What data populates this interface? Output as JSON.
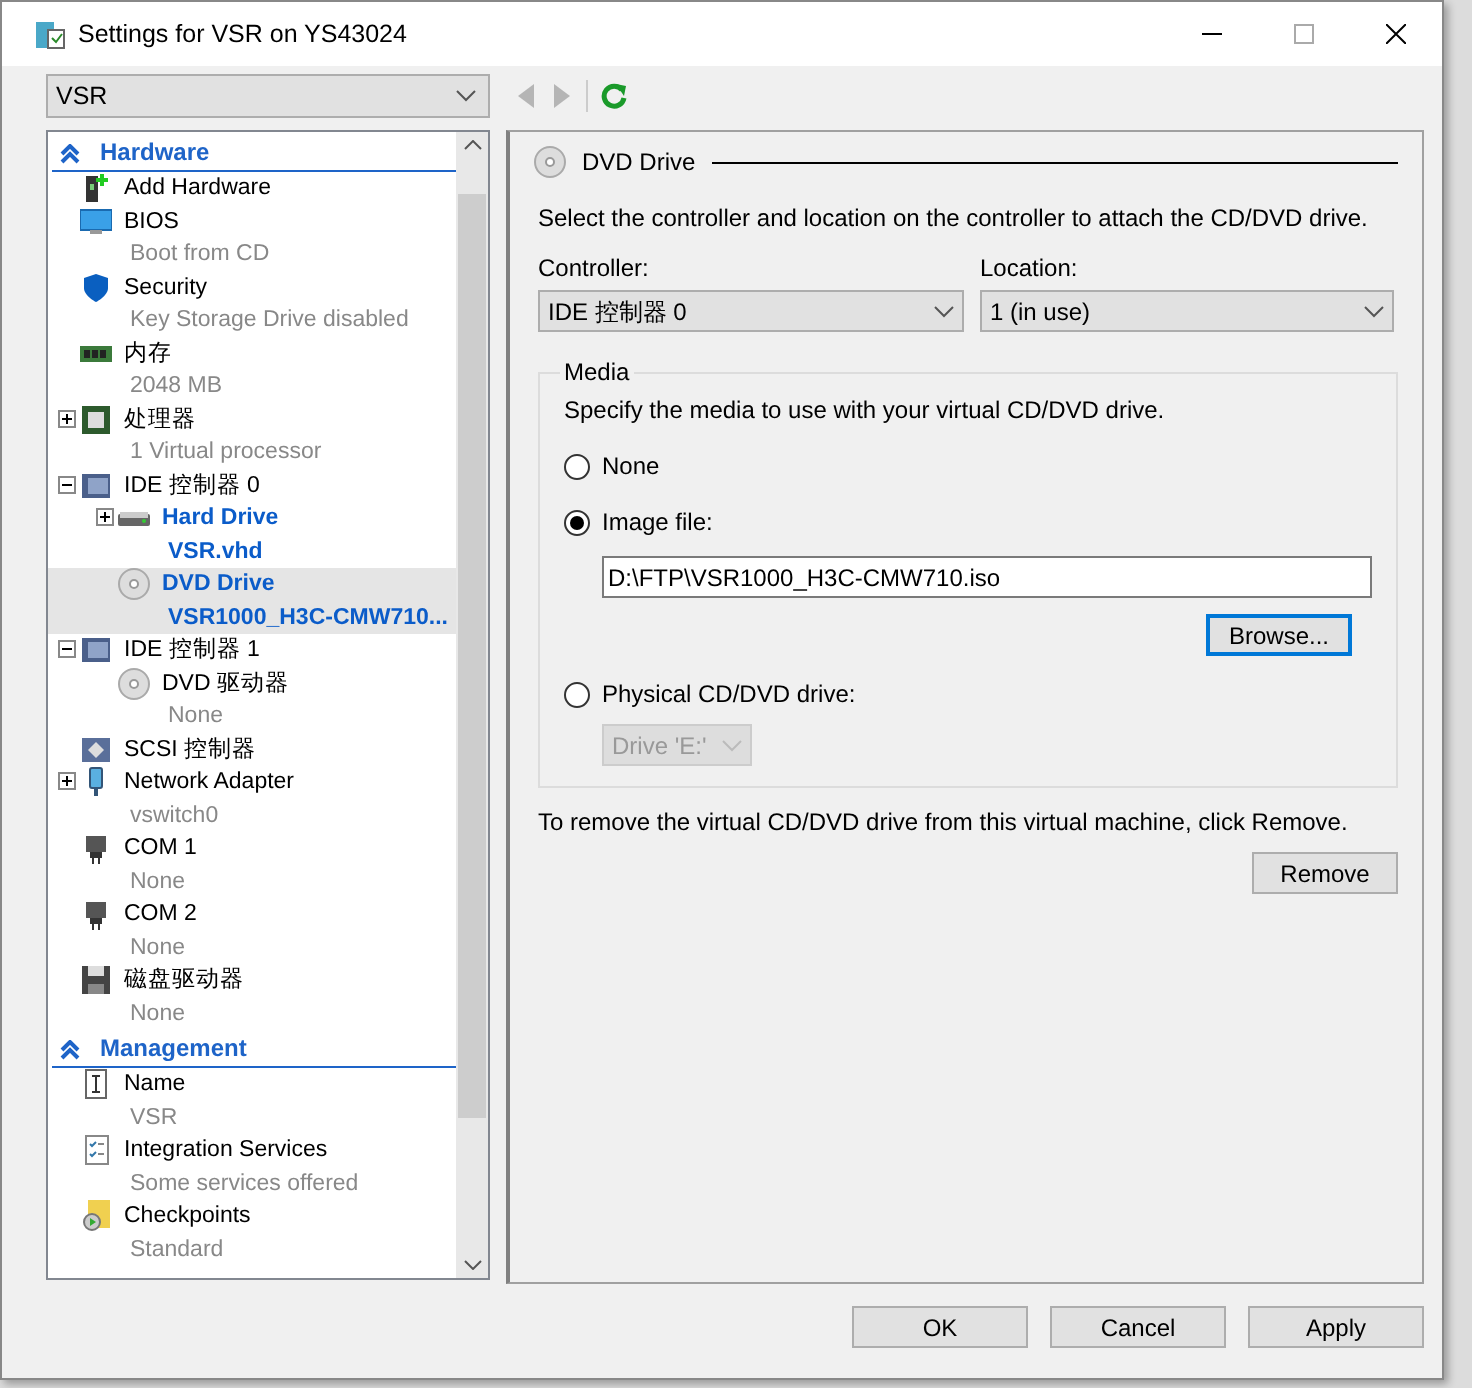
{
  "window": {
    "title": "Settings for VSR on YS43024"
  },
  "vm_selector": {
    "value": "VSR"
  },
  "tree": [
    {
      "kind": "section",
      "name": "Hardware",
      "expanded": true
    },
    {
      "kind": "add-hardware",
      "name": "Add Hardware",
      "selected": false
    },
    {
      "kind": "bios",
      "name": "BIOS",
      "detail": "Boot from CD",
      "selected": false
    },
    {
      "kind": "security",
      "name": "Security",
      "detail": "Key Storage Drive disabled",
      "selected": false
    },
    {
      "kind": "memory",
      "name": "内存",
      "detail": "2048 MB",
      "selected": false
    },
    {
      "kind": "processor",
      "name": "处理器",
      "detail": "1 Virtual processor",
      "expanded": false,
      "selected": false
    },
    {
      "kind": "controller",
      "name": "IDE 控制器 0",
      "expanded": true,
      "selected": false,
      "children": [
        {
          "kind": "hard-drive",
          "name": "Hard Drive",
          "detail": "VSR.vhd",
          "modified": true,
          "expanded": false,
          "selected": false
        },
        {
          "kind": "dvd",
          "name": "DVD Drive",
          "detail": "VSR1000_H3C-CMW710...",
          "modified": true,
          "selected": true
        }
      ]
    },
    {
      "kind": "controller",
      "name": "IDE 控制器 1",
      "expanded": true,
      "selected": false,
      "children": [
        {
          "kind": "dvd",
          "name": "DVD 驱动器",
          "detail": "None",
          "modified": false,
          "selected": false
        }
      ]
    },
    {
      "kind": "scsi",
      "name": "SCSI 控制器",
      "selected": false
    },
    {
      "kind": "network",
      "name": "Network Adapter",
      "detail": "vswitch0",
      "expanded": false,
      "selected": false
    },
    {
      "kind": "com",
      "name": "COM 1",
      "detail": "None",
      "selected": false
    },
    {
      "kind": "com",
      "name": "COM 2",
      "detail": "None",
      "selected": false
    },
    {
      "kind": "floppy",
      "name": "磁盘驱动器",
      "detail": "None",
      "selected": false
    },
    {
      "kind": "section",
      "name": "Management",
      "expanded": true
    },
    {
      "kind": "name",
      "name": "Name",
      "detail": "VSR",
      "selected": false
    },
    {
      "kind": "integration",
      "name": "Integration Services",
      "detail": "Some services offered",
      "selected": false
    },
    {
      "kind": "checkpoint",
      "name": "Checkpoints",
      "detail": "Standard",
      "selected": false
    }
  ],
  "toolbar": [
    {
      "kind": "back",
      "disabled": true
    },
    {
      "kind": "forward",
      "disabled": true
    },
    {
      "kind": "refresh",
      "disabled": false
    }
  ],
  "panel": {
    "title": "DVD Drive",
    "intro": "Select the controller and location on the controller to attach the CD/DVD drive.",
    "controller": {
      "label": "Controller:",
      "value": "IDE 控制器 0"
    },
    "location": {
      "label": "Location:",
      "value": "1 (in use)"
    },
    "media": {
      "legend": "Media",
      "hint": "Specify the media to use with your virtual CD/DVD drive.",
      "options": [
        {
          "kind": "plain",
          "label": "None",
          "selected": false
        },
        {
          "kind": "image",
          "label": "Image file:",
          "selected": true,
          "path": "D:\\FTP\\VSR1000_H3C-CMW710.iso",
          "browse": {
            "label": "Browse...",
            "focused": true
          }
        },
        {
          "kind": "physical",
          "label": "Physical CD/DVD drive:",
          "selected": false,
          "drive": {
            "value": "Drive 'E:'",
            "disabled": true
          }
        }
      ]
    },
    "remove_hint": "To remove the virtual CD/DVD drive from this virtual machine, click Remove.",
    "remove_button": "Remove"
  },
  "buttons": [
    "OK",
    "Cancel",
    "Apply"
  ]
}
